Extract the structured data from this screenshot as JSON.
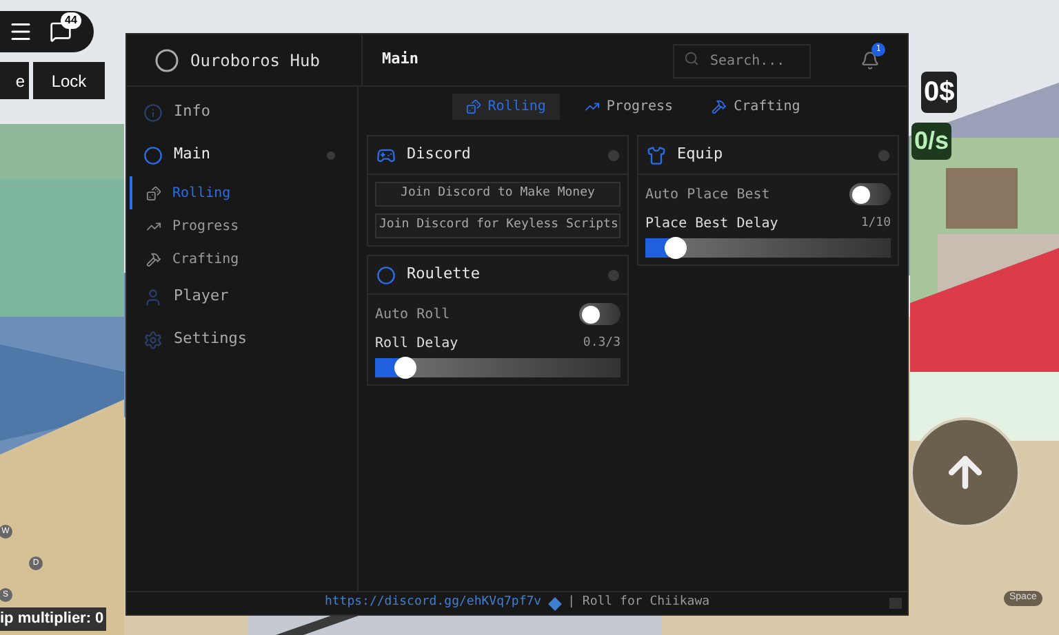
{
  "hud": {
    "chat_badge": "44",
    "buttons": [
      "e",
      "Lock"
    ],
    "money": "0$",
    "rate": "0/s",
    "multiplier": "ip multiplier: 0",
    "keys": [
      "W",
      "D",
      "S"
    ],
    "space_key": "Space"
  },
  "window": {
    "title": "Ouroboros Hub",
    "page_title": "Main",
    "search": {
      "placeholder": "Search..."
    },
    "notification_badge": "1"
  },
  "sidebar": {
    "items": [
      {
        "label": "Info",
        "selected": false
      },
      {
        "label": "Main",
        "selected": false,
        "expanded": true,
        "children": [
          {
            "label": "Rolling",
            "selected": true
          },
          {
            "label": "Progress",
            "selected": false
          },
          {
            "label": "Crafting",
            "selected": false
          }
        ]
      },
      {
        "label": "Player",
        "selected": false
      },
      {
        "label": "Settings",
        "selected": false
      }
    ]
  },
  "tabs": [
    {
      "label": "Rolling",
      "selected": true
    },
    {
      "label": "Progress",
      "selected": false
    },
    {
      "label": "Crafting",
      "selected": false
    }
  ],
  "columns": [
    [
      {
        "title": "Discord",
        "rows": [
          {
            "kind": "button",
            "label": "Join Discord to Make Money"
          },
          {
            "kind": "button",
            "label": "Join Discord for Keyless Scripts"
          }
        ]
      },
      {
        "title": "Roulette",
        "rows": [
          {
            "kind": "toggle",
            "label": "Auto Roll",
            "on": false
          },
          {
            "kind": "slider",
            "label": "Roll Delay",
            "reading": "0.3/3",
            "level": 0.1
          }
        ]
      }
    ],
    [
      {
        "title": "Equip",
        "rows": [
          {
            "kind": "toggle",
            "label": "Auto Place Best",
            "on": false
          },
          {
            "kind": "slider",
            "label": "Place Best Delay",
            "reading": "1/10",
            "level": 0.1
          }
        ]
      }
    ]
  ],
  "footer": {
    "link": "https://discord.gg/ehKVq7pf7v",
    "text": "| Roll for Chiikawa"
  }
}
